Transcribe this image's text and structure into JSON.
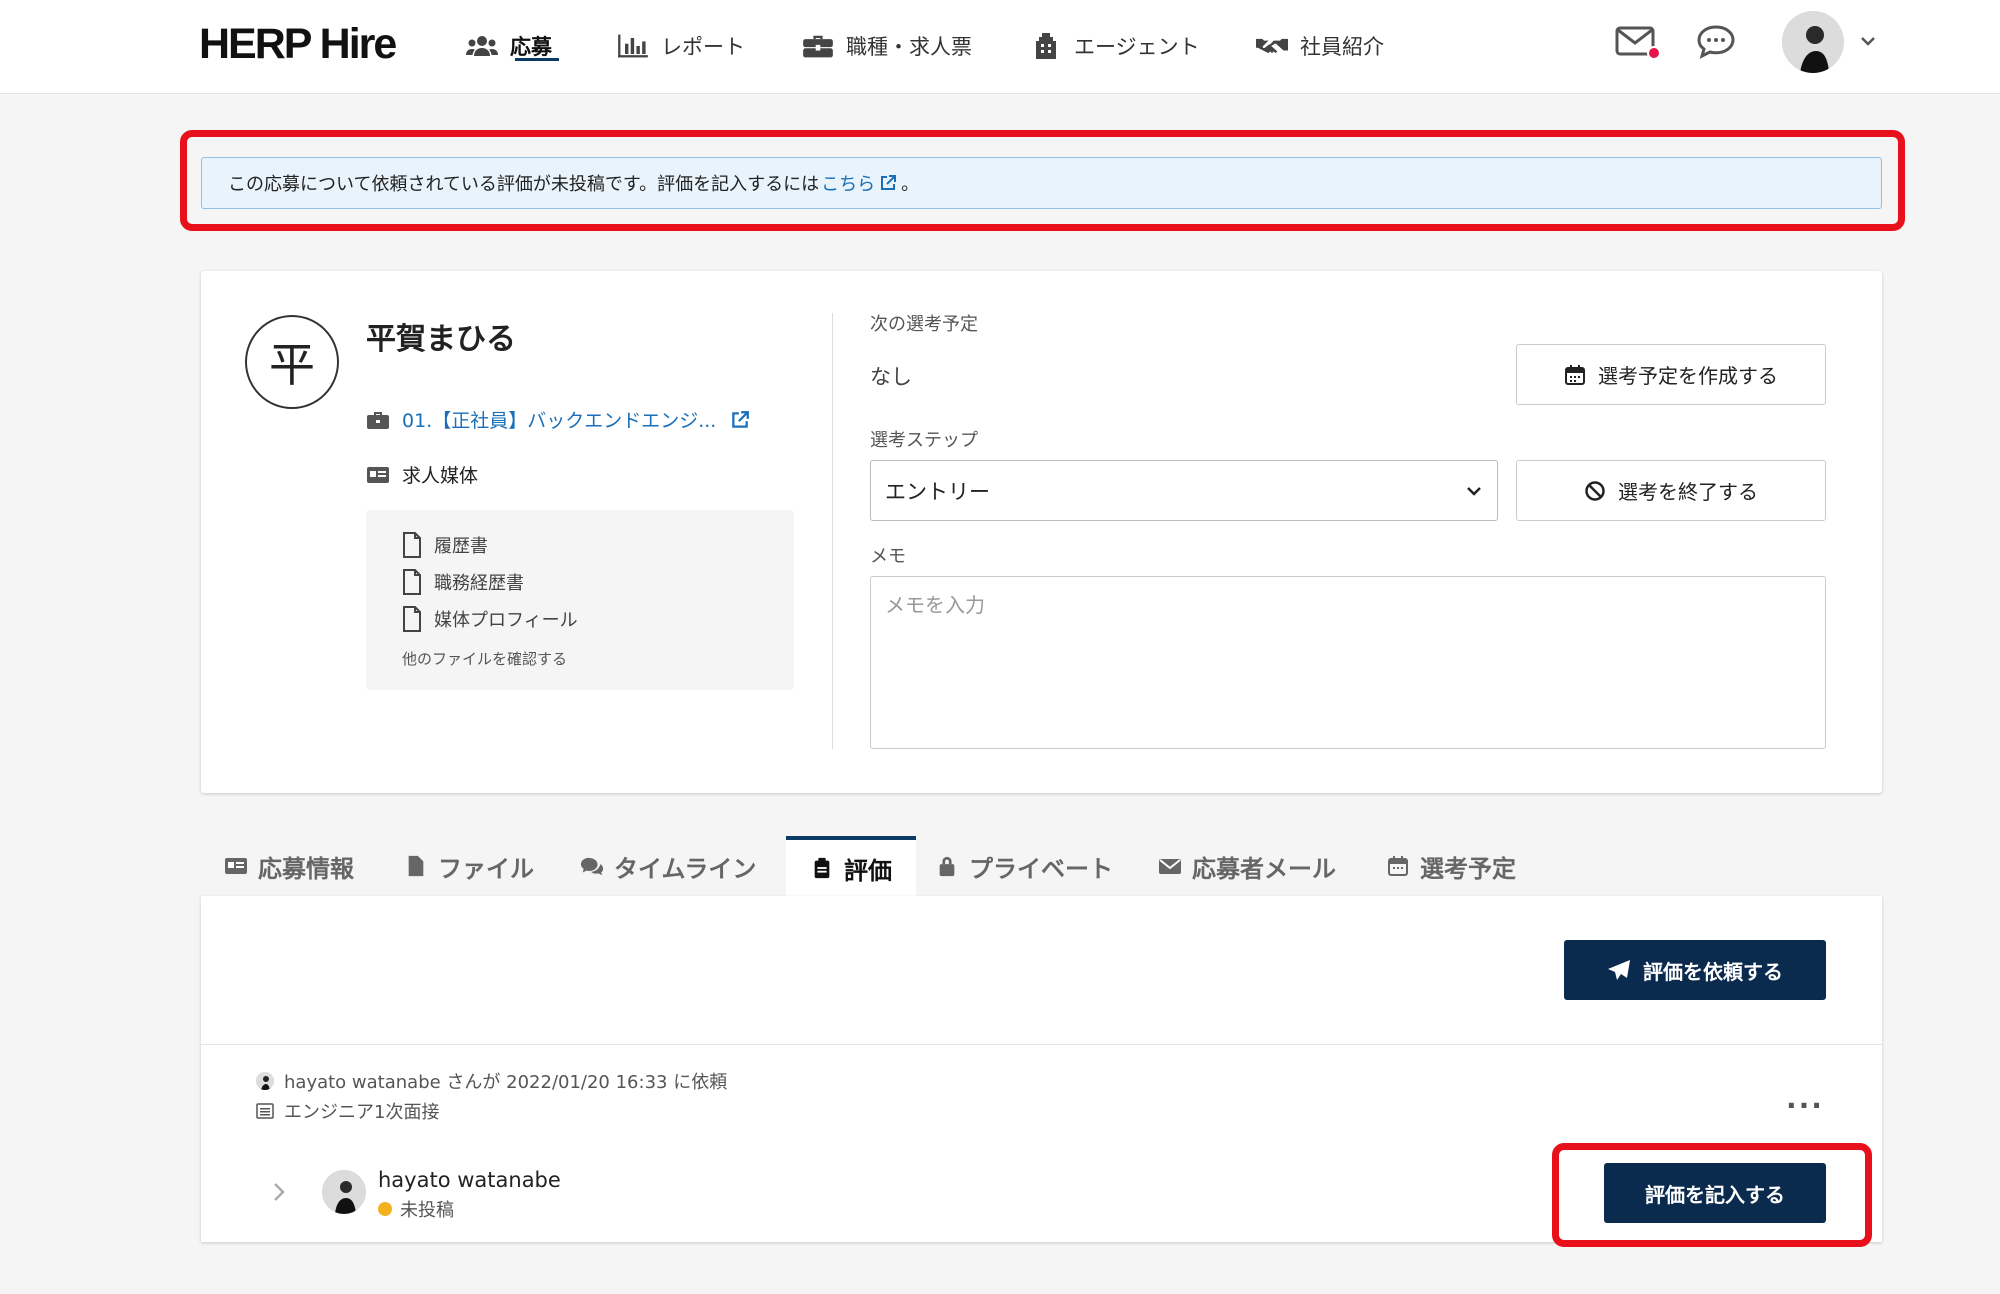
{
  "header": {
    "logo": "HERP Hire",
    "nav": [
      {
        "label": "応募",
        "icon": "users-icon",
        "active": true
      },
      {
        "label": "レポート",
        "icon": "bar-chart-icon"
      },
      {
        "label": "職種・求人票",
        "icon": "briefcase-icon"
      },
      {
        "label": "エージェント",
        "icon": "building-icon"
      },
      {
        "label": "社員紹介",
        "icon": "handshake-icon"
      }
    ],
    "icons": [
      "mail-icon",
      "chat-icon"
    ],
    "notification_color": "#e4144a"
  },
  "alert": {
    "text": "この応募について依頼されている評価が未投稿です。評価を記入するには",
    "link": "こちら",
    "suffix": "。"
  },
  "candidate": {
    "initial": "平",
    "name": "平賀まひる",
    "job": "01.【正社員】バックエンドエンジ...",
    "source": "求人媒体",
    "files": [
      "履歴書",
      "職務経歴書",
      "媒体プロフィール"
    ],
    "more_files": "他のファイルを確認する"
  },
  "selection": {
    "next_label": "次の選考予定",
    "next_value": "なし",
    "create_btn": "選考予定を作成する",
    "step_label": "選考ステップ",
    "step_value": "エントリー",
    "end_btn": "選考を終了する",
    "memo_label": "メモ",
    "memo_placeholder": "メモを入力"
  },
  "tabs": [
    {
      "label": "応募情報",
      "icon": "id-card-icon"
    },
    {
      "label": "ファイル",
      "icon": "file-icon"
    },
    {
      "label": "タイムライン",
      "icon": "comments-icon"
    },
    {
      "label": "評価",
      "icon": "clipboard-icon",
      "active": true
    },
    {
      "label": "プライベート",
      "icon": "lock-icon"
    },
    {
      "label": "応募者メール",
      "icon": "envelope-icon"
    },
    {
      "label": "選考予定",
      "icon": "calendar-icon"
    }
  ],
  "evaluation": {
    "request_btn": "評価を依頼する",
    "request_info": "hayato watanabe さんが 2022/01/20 16:33 に依頼",
    "interview": "エンジニア1次面接",
    "more": "...",
    "evaluator": "hayato watanabe",
    "status": "未投稿",
    "write_btn": "評価を記入する"
  },
  "colors": {
    "primary": "#0b2b4e",
    "highlight": "#e8101a",
    "link": "#1a6fb8",
    "pending": "#f2b21f"
  }
}
